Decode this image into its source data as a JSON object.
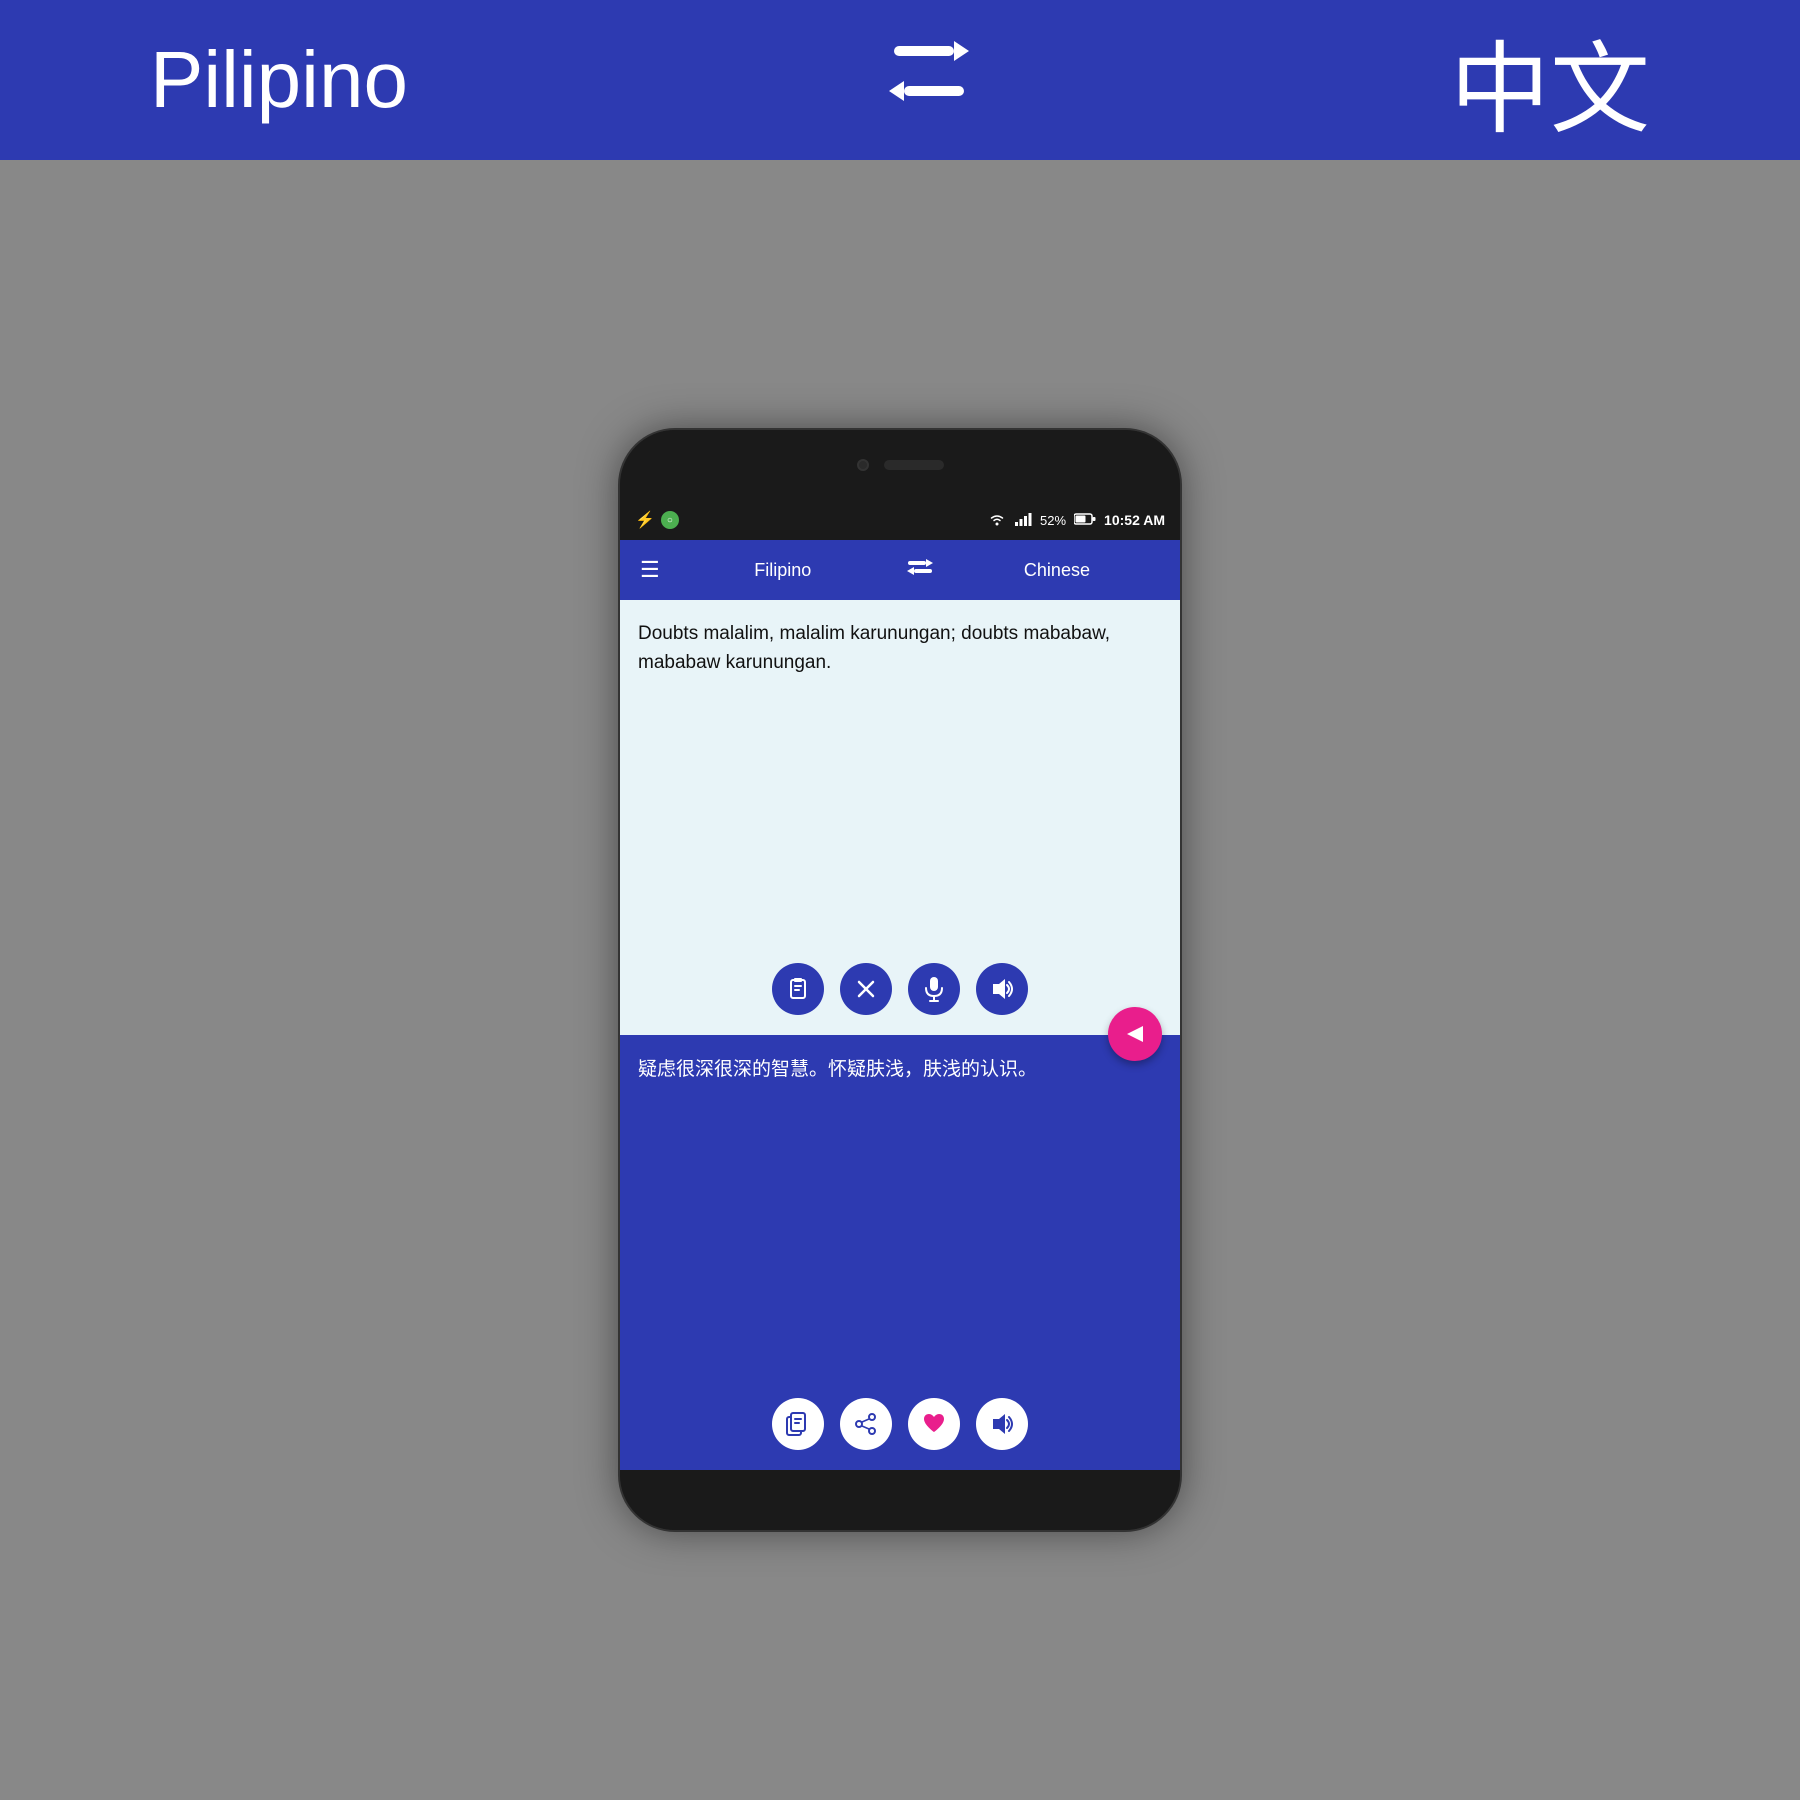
{
  "banner": {
    "lang_left": "Pilipino",
    "lang_right": "中文",
    "swap_icon": "⇄"
  },
  "status_bar": {
    "usb_icon": "⚡",
    "battery_percent": "52%",
    "time": "10:52 AM"
  },
  "app_bar": {
    "menu_icon": "☰",
    "lang_left": "Filipino",
    "swap_icon": "⇄",
    "lang_right": "Chinese"
  },
  "input_panel": {
    "text": "Doubts malalim, malalim karunungan; doubts mababaw, mababaw karunungan.",
    "btn_clipboard": "📋",
    "btn_clear": "✕",
    "btn_mic": "🎤",
    "btn_speaker": "🔊"
  },
  "translate_btn": "▶",
  "output_panel": {
    "text": "疑虑很深很深的智慧。怀疑肤浅，肤浅的认识。",
    "btn_copy": "📋",
    "btn_share": "↗",
    "btn_favorite": "♥",
    "btn_speaker": "🔊"
  }
}
